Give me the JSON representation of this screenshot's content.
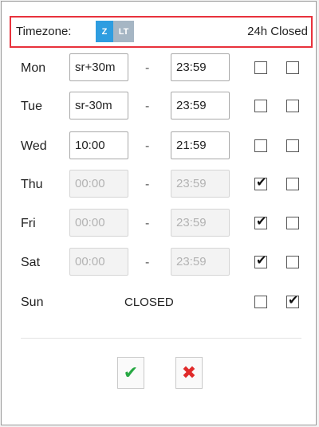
{
  "timezone": {
    "label": "Timezone:",
    "z_label": "Z",
    "lt_label": "LT",
    "closed_24h_label": "24h Closed"
  },
  "separator": "-",
  "days": [
    {
      "name": "Mon",
      "from": "sr+30m",
      "to": "23:59",
      "disabled": false,
      "check1": false,
      "check2": false
    },
    {
      "name": "Tue",
      "from": "sr-30m",
      "to": "23:59",
      "disabled": false,
      "check1": false,
      "check2": false
    },
    {
      "name": "Wed",
      "from": "10:00",
      "to": "21:59",
      "disabled": false,
      "check1": false,
      "check2": false
    },
    {
      "name": "Thu",
      "from": "00:00",
      "to": "23:59",
      "disabled": true,
      "check1": true,
      "check2": false
    },
    {
      "name": "Fri",
      "from": "00:00",
      "to": "23:59",
      "disabled": true,
      "check1": true,
      "check2": false
    },
    {
      "name": "Sat",
      "from": "00:00",
      "to": "23:59",
      "disabled": true,
      "check1": true,
      "check2": false
    },
    {
      "name": "Sun",
      "closed_text": "CLOSED",
      "check1": false,
      "check2": true
    }
  ],
  "icons": {
    "checkmark": "check-icon",
    "cancel": "close-icon"
  },
  "colors": {
    "timezone_border": "#e8323c",
    "z_active": "#2e9de0",
    "lt_inactive": "#a6b6c4",
    "ok": "#27a843",
    "cancel": "#e02a2a"
  }
}
